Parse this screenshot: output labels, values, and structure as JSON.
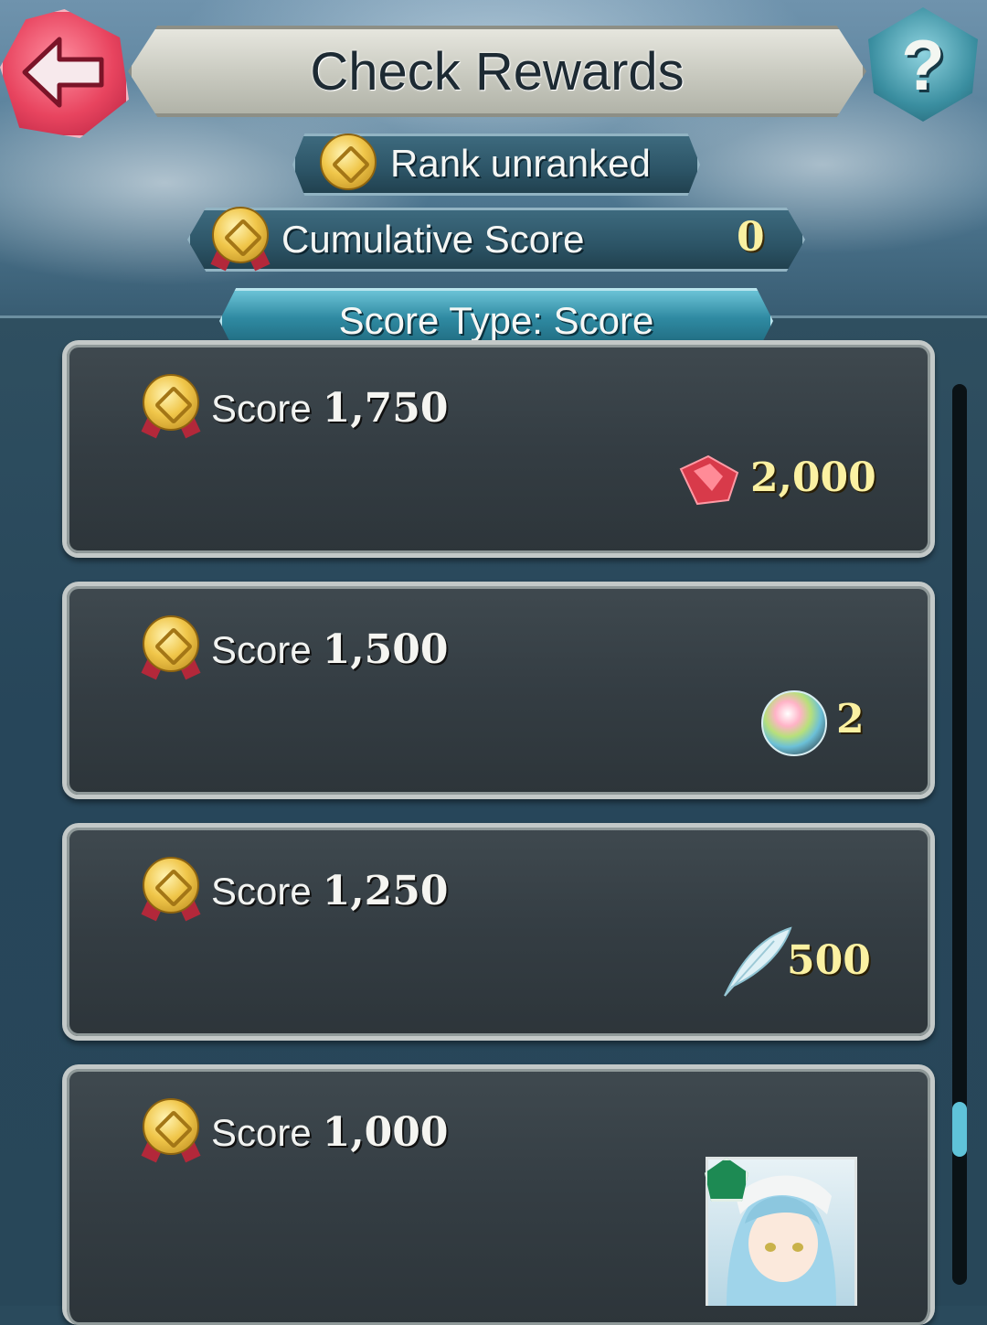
{
  "header": {
    "title": "Check Rewards",
    "help_label": "?"
  },
  "rank": {
    "label": "Rank  unranked"
  },
  "cumulative": {
    "label": "Cumulative Score",
    "value": "0"
  },
  "score_type": {
    "label": "Score Type: Score"
  },
  "rewards": [
    {
      "label": "Score",
      "value": "1,750",
      "reward_icon": "orb-gem-icon",
      "reward_qty": "2,000"
    },
    {
      "label": "Score",
      "value": "1,500",
      "reward_icon": "rainbow-orb-icon",
      "reward_qty": "2"
    },
    {
      "label": "Score",
      "value": "1,250",
      "reward_icon": "feather-icon",
      "reward_qty": "500"
    },
    {
      "label": "Score",
      "value": "1,000",
      "reward_icon": "hero-portrait",
      "reward_qty": ""
    }
  ],
  "colors": {
    "accent_teal": "#2f8aa2",
    "gold_text": "#fbf1a2",
    "back_button": "#e8445f"
  },
  "scroll": {
    "position_fraction": 0.85
  }
}
